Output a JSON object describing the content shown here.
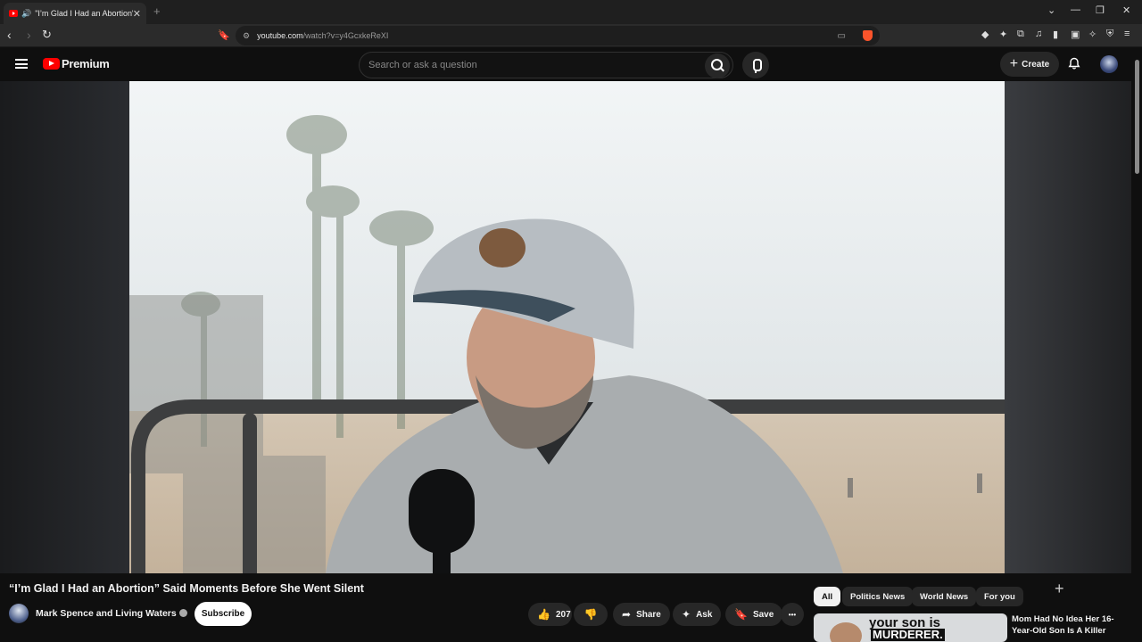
{
  "browser": {
    "tab_title": "\"I’m Glad I Had an Abortion\"",
    "tab_close": "✕",
    "new_tab": "+",
    "url_host": "youtube.com",
    "url_path": "/watch?v=y4GcxkeReXI",
    "window_controls": [
      "⌄",
      "—",
      "❐",
      "✕"
    ]
  },
  "youtube": {
    "brand": "Premium",
    "search_placeholder": "Search or ask a question",
    "create_label": "Create",
    "video_title": "“I’m Glad I Had an Abortion” Said Moments Before She Went Silent",
    "channel_name": "Mark Spence and Living Waters",
    "subscribe_label": "Subscribe",
    "like_count": "207",
    "share_label": "Share",
    "ask_label": "Ask",
    "save_label": "Save",
    "more_label": "•••",
    "chips": [
      "All",
      "Politics News",
      "World News",
      "For you"
    ],
    "recommended": {
      "title": "Mom Had No Idea Her 16-Year-Old Son Is A Killer",
      "thumb_line1": "your son is",
      "thumb_line2": "MURDERER."
    }
  },
  "colors": {
    "youtube_red": "#ff0000",
    "background": "#0f0f0f",
    "pill": "#272727"
  }
}
